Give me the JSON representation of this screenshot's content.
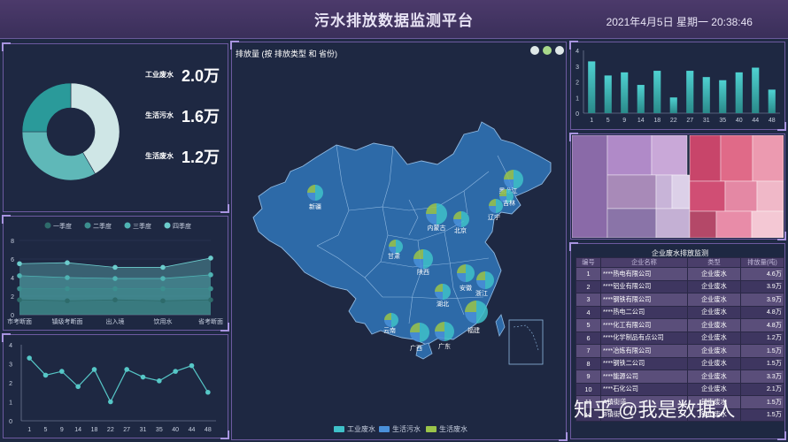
{
  "header": {
    "title": "污水排放数据监测平台",
    "datetime": "2021年4月5日 星期一    20:38:46"
  },
  "stats": [
    {
      "label": "工业废水",
      "value": "2.0万"
    },
    {
      "label": "生活污水",
      "value": "1.6万"
    },
    {
      "label": "生活废水",
      "value": "1.2万"
    }
  ],
  "donut": {
    "segments": [
      {
        "value": 2.0,
        "color": "#cfe6e6"
      },
      {
        "value": 1.6,
        "color": "#5fb8b8"
      },
      {
        "value": 1.2,
        "color": "#2a9a9a"
      }
    ]
  },
  "area_chart": {
    "legend": [
      "一季度",
      "二季度",
      "三季度",
      "四季度"
    ],
    "categories": [
      "市考断面",
      "镇级考断面",
      "出入境",
      "饮用水",
      "省考断面"
    ],
    "y_ticks": [
      "0",
      "2",
      "4",
      "6",
      "8"
    ],
    "colors": [
      "#2e6b6b",
      "#3c8f8f",
      "#4fb3b3",
      "#6ccccc"
    ]
  },
  "chart_data": [
    {
      "type": "area",
      "title": "",
      "categories": [
        "市考断面",
        "镇级考断面",
        "出入境",
        "饮用水",
        "省考断面"
      ],
      "ylim": [
        0,
        8
      ],
      "series": [
        {
          "name": "一季度",
          "values": [
            1.6,
            1.5,
            1.6,
            1.5,
            1.6
          ]
        },
        {
          "name": "二季度",
          "values": [
            2.8,
            2.8,
            2.8,
            2.8,
            2.8
          ]
        },
        {
          "name": "三季度",
          "values": [
            4.2,
            4.0,
            3.9,
            3.9,
            4.3
          ]
        },
        {
          "name": "四季度",
          "values": [
            5.5,
            5.6,
            5.1,
            5.1,
            6.1
          ]
        }
      ]
    },
    {
      "type": "line",
      "title": "",
      "categories": [
        "1",
        "5",
        "9",
        "14",
        "18",
        "22",
        "27",
        "31",
        "35",
        "40",
        "44",
        "48"
      ],
      "ylim": [
        0,
        4
      ],
      "values": [
        3.3,
        2.4,
        2.6,
        1.8,
        2.7,
        1.0,
        2.7,
        2.3,
        2.1,
        2.6,
        2.9,
        1.5
      ]
    },
    {
      "type": "bar",
      "title": "",
      "categories": [
        "1",
        "5",
        "9",
        "14",
        "18",
        "22",
        "27",
        "31",
        "35",
        "40",
        "44",
        "48"
      ],
      "ylim": [
        0,
        4
      ],
      "values": [
        3.3,
        2.4,
        2.6,
        1.8,
        2.7,
        1.0,
        2.7,
        2.3,
        2.1,
        2.6,
        2.9,
        1.5
      ]
    }
  ],
  "line_chart": {
    "y_ticks": [
      "0",
      "1",
      "2",
      "3",
      "4"
    ]
  },
  "bar_chart": {
    "y_ticks": [
      "0",
      "1",
      "2",
      "3",
      "4"
    ]
  },
  "map": {
    "title": "排放量 (按 排放类型 和 省份)",
    "legend": [
      {
        "label": "工业废水",
        "color": "#3fc1c9"
      },
      {
        "label": "生活污水",
        "color": "#4a90d9"
      },
      {
        "label": "生活废水",
        "color": "#9bc44a"
      }
    ],
    "provinces": [
      "新疆",
      "内蒙古",
      "黑龙江",
      "吉林",
      "辽宁",
      "北京",
      "甘肃",
      "陕西",
      "安徽",
      "浙江",
      "湖北",
      "福建",
      "云南",
      "广西",
      "广东"
    ]
  },
  "table": {
    "title": "企业废水排放监测",
    "headers": [
      "编号",
      "企业名称",
      "类型",
      "排放量(吨)"
    ],
    "rows": [
      [
        "1",
        "****热电有限公司",
        "企业废水",
        "4.6万"
      ],
      [
        "2",
        "****铝业有限公司",
        "企业废水",
        "3.9万"
      ],
      [
        "3",
        "****钢铁有限公司",
        "企业废水",
        "3.9万"
      ],
      [
        "4",
        "****热电二公司",
        "企业废水",
        "4.8万"
      ],
      [
        "5",
        "****化工有限公司",
        "企业废水",
        "4.8万"
      ],
      [
        "6",
        "****化学制品有点公司",
        "企业废水",
        "1.2万"
      ],
      [
        "7",
        "****冶炼有限公司",
        "企业废水",
        "1.5万"
      ],
      [
        "8",
        "****钢铁二公司",
        "企业废水",
        "1.5万"
      ],
      [
        "9",
        "****能源公司",
        "企业废水",
        "3.3万"
      ],
      [
        "10",
        "****石化公司",
        "企业废水",
        "2.1万"
      ],
      [
        "11",
        "A镇街道",
        "镇街废水",
        "1.5万"
      ],
      [
        "12",
        "B镇街",
        "镇街废水",
        "1.5万"
      ]
    ]
  },
  "treemap": {
    "colors": [
      "#8a6aa8",
      "#b98fc0",
      "#d8c4e4",
      "#c8456a",
      "#e07090",
      "#f0b8c8",
      "#6a4a8a"
    ]
  },
  "watermark": "知乎 @我是数据人"
}
